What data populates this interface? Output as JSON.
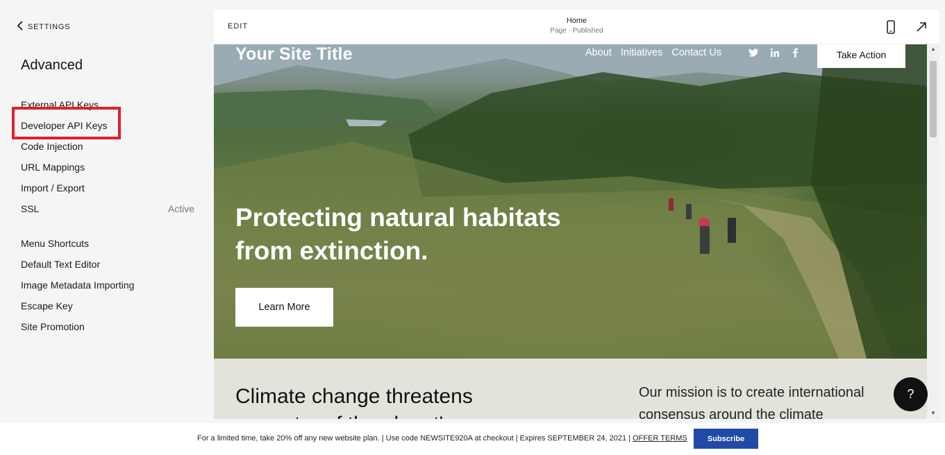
{
  "sidebar": {
    "back_label": "SETTINGS",
    "section_title": "Advanced",
    "items_group1": [
      {
        "label": "External API Keys",
        "status": ""
      },
      {
        "label": "Developer API Keys",
        "status": ""
      },
      {
        "label": "Code Injection",
        "status": ""
      },
      {
        "label": "URL Mappings",
        "status": ""
      },
      {
        "label": "Import / Export",
        "status": ""
      },
      {
        "label": "SSL",
        "status": "Active"
      }
    ],
    "items_group2": [
      {
        "label": "Menu Shortcuts"
      },
      {
        "label": "Default Text Editor"
      },
      {
        "label": "Image Metadata Importing"
      },
      {
        "label": "Escape Key"
      },
      {
        "label": "Site Promotion"
      }
    ]
  },
  "preview_bar": {
    "edit_label": "EDIT",
    "page_name": "Home",
    "page_status": "Page · Published"
  },
  "site": {
    "title": "Your Site Title",
    "nav": [
      "About",
      "Initiatives",
      "Contact Us"
    ],
    "cta": "Take Action",
    "headline_line1": "Protecting natural habitats",
    "headline_line2": "from extinction.",
    "learn_more": "Learn More",
    "section_heading_line1": "Climate change threatens",
    "section_heading_line2": "a quarter of the planet's",
    "mission_line1": "Our mission is to create international",
    "mission_line2": "consensus around the climate"
  },
  "help_label": "?",
  "promo": {
    "text": "For a limited time, take 20% off any new website plan. | Use code NEWSITE920A at checkout | Expires SEPTEMBER 24, 2021 | ",
    "offer_link": "OFFER TERMS",
    "subscribe_label": "Subscribe"
  },
  "colors": {
    "highlight": "#e3202a",
    "subscribe": "#1f4aa8"
  }
}
